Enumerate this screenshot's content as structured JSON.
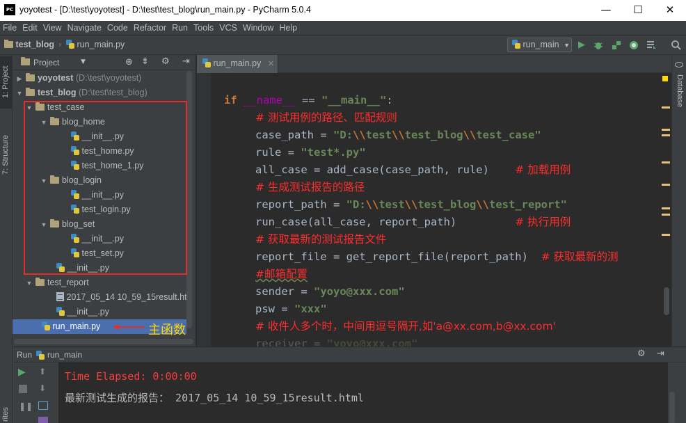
{
  "window": {
    "app_icon_text": "PC",
    "title": "yoyotest - [D:\\test\\yoyotest] - D:\\test\\test_blog\\run_main.py - PyCharm 5.0.4",
    "minimize": "—",
    "maximize": "☐",
    "close": "✕"
  },
  "menu": [
    "File",
    "Edit",
    "View",
    "Navigate",
    "Code",
    "Refactor",
    "Run",
    "Tools",
    "VCS",
    "Window",
    "Help"
  ],
  "navbar": {
    "project": "test_blog",
    "file": "run_main.py",
    "run_config": "run_main"
  },
  "left_tabs": {
    "project": "1: Project",
    "structure": "7: Structure",
    "favorites": "rites"
  },
  "right_tabs": {
    "database": "Database"
  },
  "project_panel": {
    "title": "Project",
    "tree": [
      {
        "name": "yoyotest",
        "path": "(D:\\test\\yoyotest)"
      },
      {
        "name": "test_blog",
        "path": "(D:\\test\\test_blog)"
      },
      {
        "name": "test_case"
      },
      {
        "name": "blog_home"
      },
      {
        "name": "__init__.py"
      },
      {
        "name": "test_home.py"
      },
      {
        "name": "test_home_1.py"
      },
      {
        "name": "blog_login"
      },
      {
        "name": "__init__.py"
      },
      {
        "name": "test_login.py"
      },
      {
        "name": "blog_set"
      },
      {
        "name": "__init__.py"
      },
      {
        "name": "test_set.py"
      },
      {
        "name": "__init__.py"
      },
      {
        "name": "test_report"
      },
      {
        "name": "2017_05_14 10_59_15result.ht"
      },
      {
        "name": "__init__.py"
      },
      {
        "name": "run_main.py"
      }
    ],
    "annotation": "主函数"
  },
  "editor": {
    "tab": "run_main.py",
    "code": {
      "l1_kw": "if",
      "l1_name": "__name__",
      "l1_eq": " == ",
      "l1_str": "\"__main__\"",
      "l1_end": ":",
      "l2": "# 测试用例的路径、匹配规则",
      "l3_a": "case_path = ",
      "l3_s1": "\"D:",
      "l3_e1": "\\\\",
      "l3_s2": "test",
      "l3_e2": "\\\\",
      "l3_s3": "test_blog",
      "l3_e3": "\\\\",
      "l3_s4": "test_case\"",
      "l4_a": "rule = ",
      "l4_s": "\"test*.py\"",
      "l5_a": "all_case = add_case(case_path, rule)    ",
      "l5_c": "# 加载用例",
      "l6": "# 生成测试报告的路径",
      "l7_a": "report_path = ",
      "l7_s1": "\"D:",
      "l7_e1": "\\\\",
      "l7_s2": "test",
      "l7_e2": "\\\\",
      "l7_s3": "test_blog",
      "l7_e3": "\\\\",
      "l7_s4": "test_report\"",
      "l8_a": "run_case(all_case, report_path)         ",
      "l8_c": "# 执行用例",
      "l9": "# 获取最新的测试报告文件",
      "l10_a": "report_file = get_report_file(report_path)  ",
      "l10_c": "# 获取最新的测",
      "l11": "#邮箱配置",
      "l12_a": "sender = ",
      "l12_s": "\"yoyo@xxx.com\"",
      "l13_a": "psw = ",
      "l13_s": "\"xxx\"",
      "l14": "# 收件人多个时，中间用逗号隔开,如'a@xx.com,b@xx.com'",
      "l15_a": "receiver = ",
      "l15_s": "\"yoyo@xxx.com\""
    }
  },
  "run_panel": {
    "label": "Run",
    "config": "run_main",
    "output": [
      {
        "text": "Time Elapsed: 0:00:00",
        "color": "#ff3c3c"
      },
      {
        "text": "最新测试生成的报告： 2017_05_14 10_59_15result.html",
        "color": "#bbbbbb"
      }
    ]
  },
  "colors": {
    "background": "#2b2b2b",
    "panel": "#3c3f41",
    "selection": "#4b6eaf",
    "keyword": "#cc7832",
    "string": "#6a8759",
    "comment_annotated": "#ff2d2d",
    "annotation_box": "#e0302a",
    "annotation_text": "#ffd800"
  }
}
